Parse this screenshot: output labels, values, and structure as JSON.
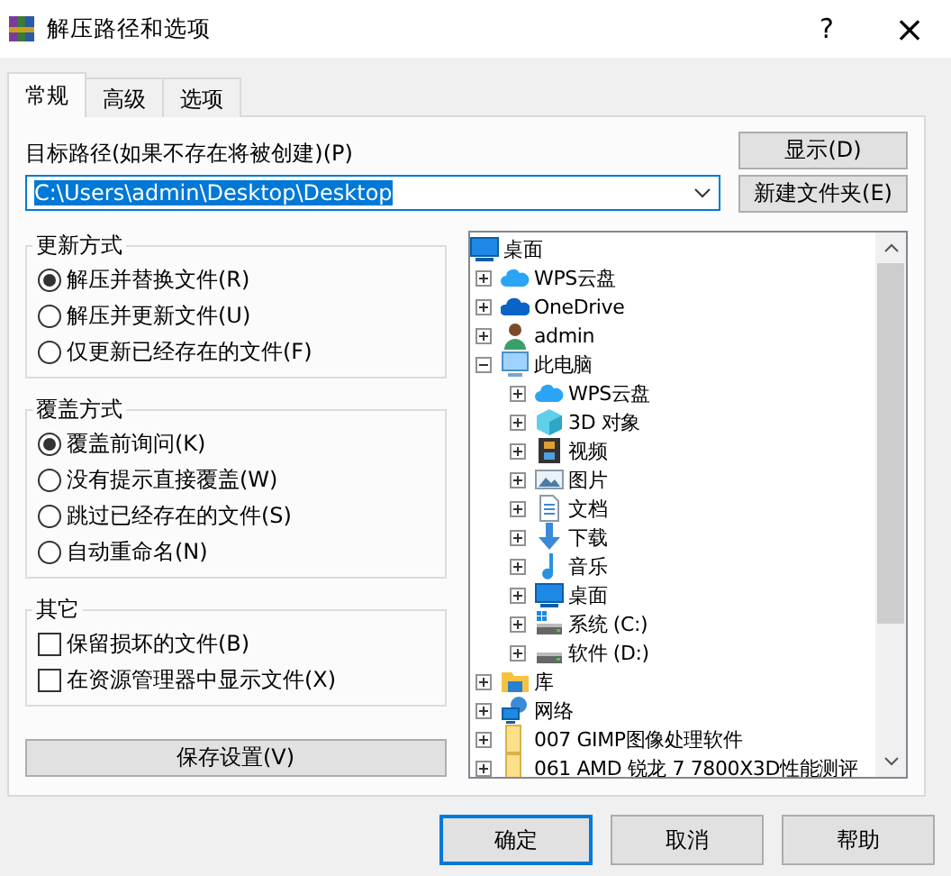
{
  "window": {
    "title": "解压路径和选项",
    "help": "?",
    "close": "×"
  },
  "tabs": [
    {
      "label": "常规",
      "selected": true
    },
    {
      "label": "高级",
      "selected": false
    },
    {
      "label": "选项",
      "selected": false
    }
  ],
  "path": {
    "label": "目标路径(如果不存在将被创建)(P)",
    "value": "C:\\Users\\admin\\Desktop\\Desktop",
    "highlighted": true
  },
  "side_buttons": [
    "显示(D)",
    "新建文件夹(E)"
  ],
  "groups": [
    {
      "title": "更新方式",
      "kind": "radio",
      "options": [
        {
          "label": "解压并替换文件(R)",
          "selected": true
        },
        {
          "label": "解压并更新文件(U)",
          "selected": false
        },
        {
          "label": "仅更新已经存在的文件(F)",
          "selected": false
        }
      ]
    },
    {
      "title": "覆盖方式",
      "kind": "radio",
      "options": [
        {
          "label": "覆盖前询问(K)",
          "selected": true
        },
        {
          "label": "没有提示直接覆盖(W)",
          "selected": false
        },
        {
          "label": "跳过已经存在的文件(S)",
          "selected": false
        },
        {
          "label": "自动重命名(N)",
          "selected": false
        }
      ]
    },
    {
      "title": "其它",
      "kind": "checkbox",
      "options": [
        {
          "label": "保留损坏的文件(B)",
          "checked": false
        },
        {
          "label": "在资源管理器中显示文件(X)",
          "checked": false
        }
      ]
    }
  ],
  "save_button": "保存设置(V)",
  "tree": {
    "label": "桌面",
    "kind": "desktop",
    "children": [
      {
        "label": "WPS云盘",
        "kind": "cloud",
        "expanded": false
      },
      {
        "label": "OneDrive",
        "kind": "onedrive",
        "expanded": false
      },
      {
        "label": "admin",
        "kind": "user",
        "expanded": false
      },
      {
        "label": "此电脑",
        "kind": "computer",
        "expanded": true,
        "children": [
          {
            "label": "WPS云盘",
            "kind": "cloud",
            "expanded": false
          },
          {
            "label": "3D 对象",
            "kind": "cube",
            "expanded": false
          },
          {
            "label": "视频",
            "kind": "video",
            "expanded": false
          },
          {
            "label": "图片",
            "kind": "image",
            "expanded": false
          },
          {
            "label": "文档",
            "kind": "document",
            "expanded": false
          },
          {
            "label": "下载",
            "kind": "download",
            "expanded": false
          },
          {
            "label": "音乐",
            "kind": "music",
            "expanded": false
          },
          {
            "label": "桌面",
            "kind": "desktop",
            "expanded": false
          },
          {
            "label": "系统 (C:)",
            "kind": "system-drive",
            "expanded": false
          },
          {
            "label": "软件 (D:)",
            "kind": "drive",
            "expanded": false
          }
        ]
      },
      {
        "label": "库",
        "kind": "library",
        "expanded": false
      },
      {
        "label": "网络",
        "kind": "network",
        "expanded": false
      },
      {
        "label": "007 GIMP图像处理软件",
        "kind": "folder",
        "expanded": false
      },
      {
        "label": "061 AMD 锐龙 7 7800X3D性能测评",
        "kind": "folder",
        "expanded": false
      }
    ]
  },
  "buttons": [
    {
      "label": "确定",
      "default": true
    },
    {
      "label": "取消",
      "default": false
    },
    {
      "label": "帮助",
      "default": false
    }
  ]
}
